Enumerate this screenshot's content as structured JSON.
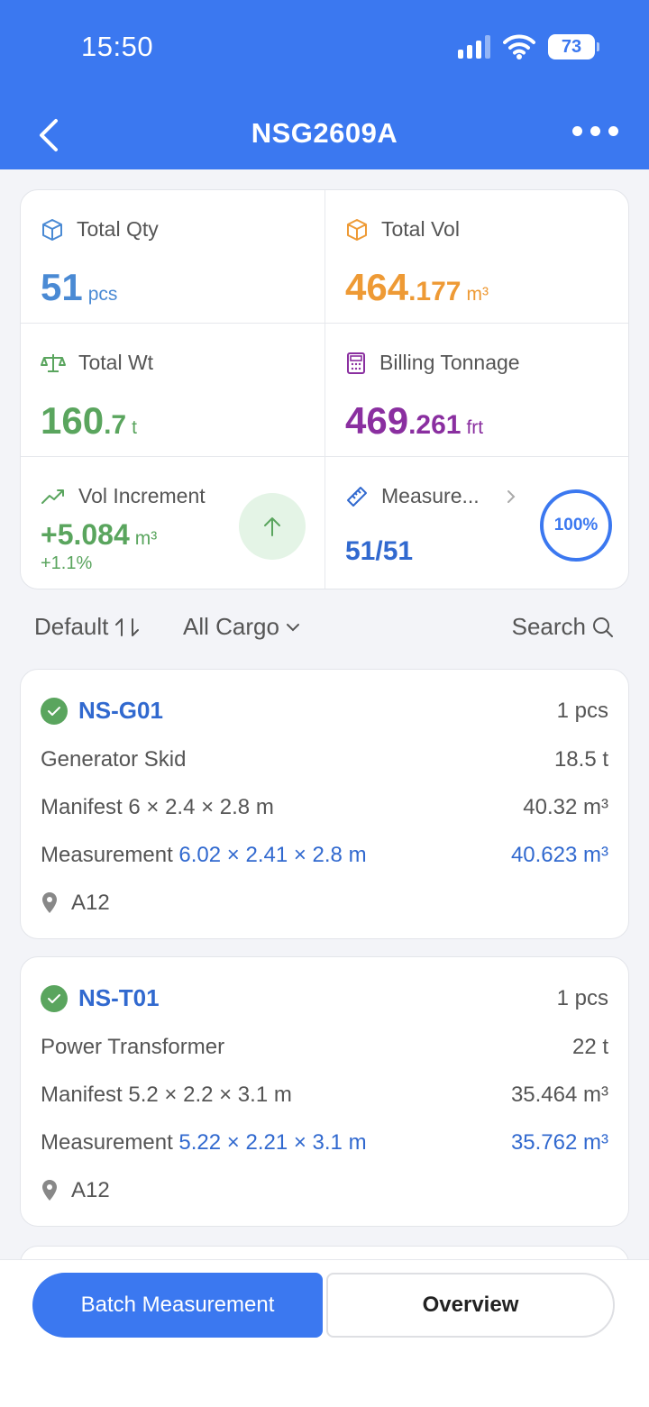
{
  "status_bar": {
    "time": "15:50",
    "battery": "73"
  },
  "nav": {
    "title": "NSG2609A"
  },
  "stats": {
    "total_qty": {
      "label": "Total Qty",
      "value": "51",
      "unit": "pcs"
    },
    "total_vol": {
      "label": "Total Vol",
      "value_int": "464",
      "value_dec": ".177",
      "unit": "m³"
    },
    "total_wt": {
      "label": "Total Wt",
      "value_int": "160",
      "value_dec": ".7",
      "unit": "t"
    },
    "billing_tonnage": {
      "label": "Billing Tonnage",
      "value_int": "469",
      "value_dec": ".261",
      "unit": "frt"
    },
    "vol_increment": {
      "label": "Vol Increment",
      "value": "+5.084",
      "unit": "m³",
      "percent": "+1.1%"
    },
    "measure": {
      "label": "Measure...",
      "value": "51/51",
      "progress": "100%"
    }
  },
  "filters": {
    "sort": "Default",
    "category": "All Cargo",
    "search": "Search"
  },
  "cargo": [
    {
      "code": "NS-G01",
      "qty": "1 pcs",
      "name": "Generator Skid",
      "weight": "18.5 t",
      "manifest_label": "Manifest",
      "manifest_dims": "6 × 2.4 × 2.8 m",
      "manifest_vol": "40.32 m³",
      "measure_label": "Measurement",
      "measure_dims": "6.02 × 2.41 × 2.8 m",
      "measure_vol": "40.623 m³",
      "location": "A12"
    },
    {
      "code": "NS-T01",
      "qty": "1 pcs",
      "name": "Power Transformer",
      "weight": "22 t",
      "manifest_label": "Manifest",
      "manifest_dims": "5.2 × 2.2 × 3.1 m",
      "manifest_vol": "35.464 m³",
      "measure_label": "Measurement",
      "measure_dims": "5.22 × 2.21 × 3.1 m",
      "measure_vol": "35.762 m³",
      "location": "A12"
    }
  ],
  "actions": {
    "batch": "Batch Measurement",
    "overview": "Overview"
  },
  "colors": {
    "primary": "#3b78f0",
    "blue": "#4a8ad4",
    "orange": "#ee9a35",
    "green": "#5aa55e",
    "purple": "#8a2fa0"
  }
}
